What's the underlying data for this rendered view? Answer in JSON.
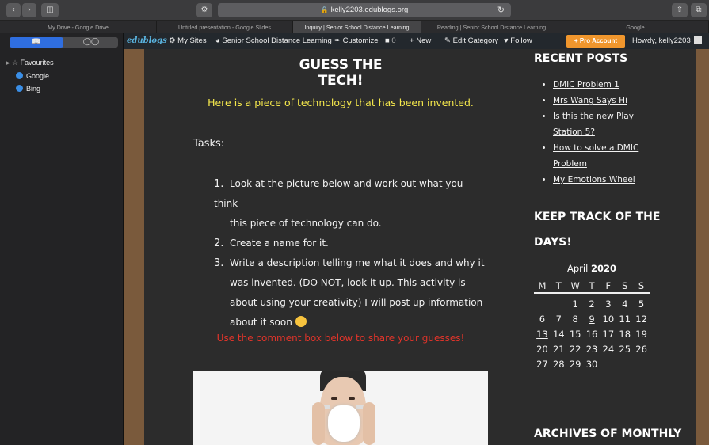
{
  "browser": {
    "url": "kelly2203.edublogs.org",
    "tabs": [
      {
        "label": "My Drive - Google Drive",
        "active": false
      },
      {
        "label": "Untitled presentation - Google Slides",
        "active": false
      },
      {
        "label": "Inquiry | Senior School Distance Learning",
        "active": true
      },
      {
        "label": "Reading | Senior School Distance Learning",
        "active": false
      },
      {
        "label": "Google",
        "active": false
      }
    ]
  },
  "sidebar": {
    "segments": [
      "bookmarks-icon",
      "reading-list-icon"
    ],
    "folder": "Favourites",
    "items": [
      {
        "label": "Google"
      },
      {
        "label": "Bing"
      }
    ]
  },
  "adminbar": {
    "logo": "edublogs",
    "my_sites": "My Sites",
    "site_name": "Senior School Distance Learning",
    "customize": "Customize",
    "comments_count": "0",
    "new": "New",
    "edit_category": "Edit Category",
    "follow": "Follow",
    "pro_account": "Pro Account",
    "howdy": "Howdy, kelly2203"
  },
  "post": {
    "title": "GUESS THE TECH!",
    "intro": "Here is a piece of technology that has been invented.",
    "tasks_label": "Tasks:",
    "tasks": [
      {
        "num": "1.",
        "text": "Look at the picture below and work out what you think",
        "cont": [
          "this piece of technology can do."
        ]
      },
      {
        "num": "2.",
        "text": "Create a name for it.",
        "cont": []
      },
      {
        "num": "3.",
        "text": "Write a description telling me what it does and why it",
        "cont": [
          "was invented. (DO NOT, look it up. This activity is",
          "about using your creativity) I will post up information",
          "about it soon"
        ]
      }
    ],
    "cta": "Use the comment box below to share your guesses!"
  },
  "recent_posts": {
    "heading": "RECENT POSTS",
    "items": [
      {
        "lines": [
          "DMIC Problem 1"
        ]
      },
      {
        "lines": [
          "Mrs Wang Says Hi"
        ]
      },
      {
        "lines": [
          "Is this the new Play",
          "Station 5?"
        ]
      },
      {
        "lines": [
          "How to solve a DMIC",
          "Problem"
        ]
      },
      {
        "lines": [
          "My Emotions Wheel"
        ]
      }
    ]
  },
  "calendar_widget": {
    "heading_line1": "KEEP TRACK OF THE",
    "heading_line2": "DAYS!",
    "month": "April",
    "year": "2020",
    "weekdays": [
      "M",
      "T",
      "W",
      "T",
      "F",
      "S",
      "S"
    ],
    "weeks": [
      [
        "",
        "",
        "1",
        "2",
        "3",
        "4",
        "5"
      ],
      [
        "6",
        "7",
        "8",
        "9",
        "10",
        "11",
        "12"
      ],
      [
        "13",
        "14",
        "15",
        "16",
        "17",
        "18",
        "19"
      ],
      [
        "20",
        "21",
        "22",
        "23",
        "24",
        "25",
        "26"
      ],
      [
        "27",
        "28",
        "29",
        "30",
        "",
        "",
        ""
      ]
    ],
    "linked_days": [
      "9",
      "13"
    ]
  },
  "archives": {
    "heading": "ARCHIVES OF MONTHLY"
  }
}
